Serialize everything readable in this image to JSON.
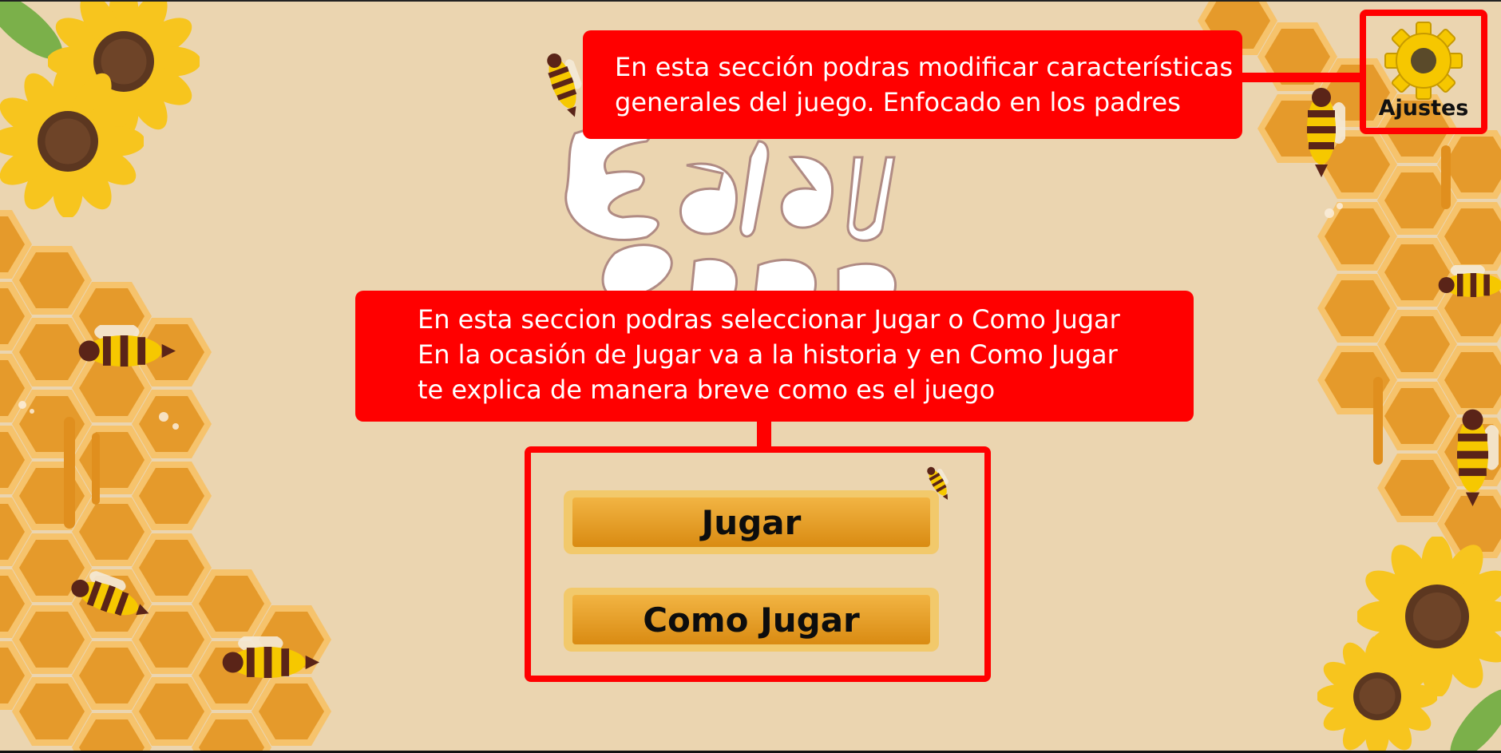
{
  "settings": {
    "label": "Ajustes",
    "icon": "gear-icon",
    "callout": "En esta sección podras modificar características\ngenerales del juego. Enfocado en los padres"
  },
  "menu": {
    "play_label": "Jugar",
    "howto_label": "Como Jugar",
    "callout": "En esta seccion podras seleccionar Jugar o Como Jugar\nEn la ocasión de Jugar va a la historia y en Como Jugar\nte explica de manera breve como es el juego"
  },
  "colors": {
    "background": "#ebd5b0",
    "annotation": "#ff0000",
    "honey": "#e8a22b",
    "gear": "#f6c700",
    "sunflower": "#f7c51e"
  }
}
